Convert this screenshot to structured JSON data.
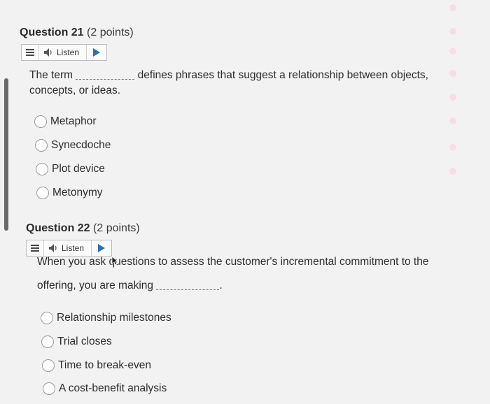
{
  "q21": {
    "title": "Question 21",
    "points": "(2 points)",
    "listen_label": "Listen",
    "text_part1": "The term",
    "text_part2": "defines phrases that suggest a relationship between objects,",
    "text_line2": "concepts, or ideas.",
    "options": [
      "Metaphor",
      "Synecdoche",
      "Plot device",
      "Metonymy"
    ]
  },
  "q22": {
    "title": "Question 22",
    "points": "(2 points)",
    "listen_label": "Listen",
    "text_line1": "When you ask questions to assess the customer's incremental commitment to the",
    "text_line2": "offering, you are making",
    "text_end": ".",
    "options": [
      "Relationship milestones",
      "Trial closes",
      "Time to break-even",
      "A cost-benefit analysis"
    ]
  },
  "icons": {
    "menu": "menu-icon",
    "speaker": "speaker-icon",
    "play": "play-icon",
    "radio": "radio-unselected"
  },
  "colors": {
    "background": "#f3f2f2",
    "accent_pink": "#f6cde1",
    "play_blue": "#2f6fb3"
  }
}
